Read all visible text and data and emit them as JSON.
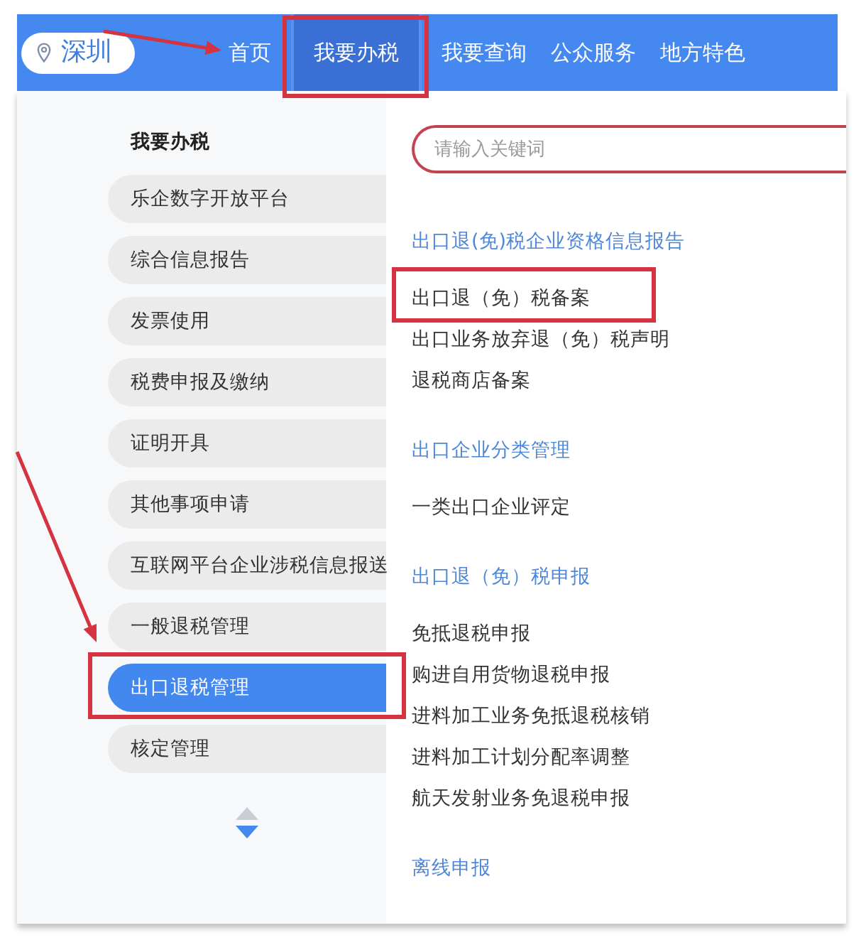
{
  "header": {
    "city": "深圳",
    "nav": [
      {
        "label": "首页",
        "selected": false,
        "annotated": false
      },
      {
        "label": "我要办税",
        "selected": true,
        "annotated": true
      },
      {
        "label": "我要查询",
        "selected": false,
        "annotated": false
      },
      {
        "label": "公众服务",
        "selected": false,
        "annotated": false
      },
      {
        "label": "地方特色",
        "selected": false,
        "annotated": false
      }
    ]
  },
  "sidebar": {
    "title": "我要办税",
    "items": [
      {
        "label": "乐企数字开放平台",
        "selected": false,
        "annotated": false
      },
      {
        "label": "综合信息报告",
        "selected": false,
        "annotated": false
      },
      {
        "label": "发票使用",
        "selected": false,
        "annotated": false
      },
      {
        "label": "税费申报及缴纳",
        "selected": false,
        "annotated": false
      },
      {
        "label": "证明开具",
        "selected": false,
        "annotated": false
      },
      {
        "label": "其他事项申请",
        "selected": false,
        "annotated": false
      },
      {
        "label": "互联网平台企业涉税信息报送",
        "selected": false,
        "annotated": false
      },
      {
        "label": "一般退税管理",
        "selected": false,
        "annotated": false
      },
      {
        "label": "出口退税管理",
        "selected": true,
        "annotated": true
      },
      {
        "label": "核定管理",
        "selected": false,
        "annotated": false
      }
    ]
  },
  "search": {
    "placeholder": "请输入关键词"
  },
  "sections": [
    {
      "heading": "出口退(免)税企业资格信息报告",
      "items": [
        {
          "label": "出口退（免）税备案",
          "annotated": true
        },
        {
          "label": "出口业务放弃退（免）税声明",
          "annotated": false
        },
        {
          "label": "退税商店备案",
          "annotated": false
        }
      ]
    },
    {
      "heading": "出口企业分类管理",
      "items": [
        {
          "label": "一类出口企业评定",
          "annotated": false
        }
      ]
    },
    {
      "heading": "出口退（免）税申报",
      "items": [
        {
          "label": "免抵退税申报",
          "annotated": false
        },
        {
          "label": "购进自用货物退税申报",
          "annotated": false
        },
        {
          "label": "进料加工业务免抵退税核销",
          "annotated": false
        },
        {
          "label": "进料加工计划分配率调整",
          "annotated": false
        },
        {
          "label": "航天发射业务免退税申报",
          "annotated": false
        }
      ]
    },
    {
      "heading": "离线申报"
    }
  ]
}
